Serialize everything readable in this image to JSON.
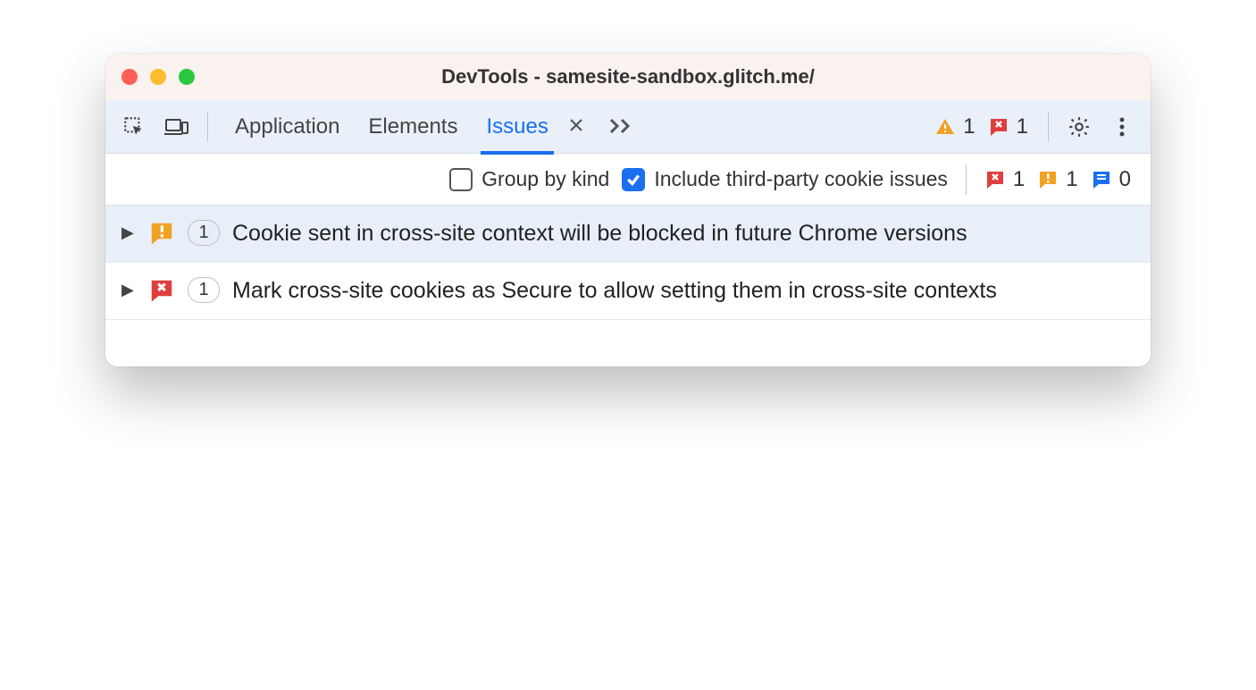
{
  "window": {
    "title": "DevTools - samesite-sandbox.glitch.me/"
  },
  "tabs": {
    "items": [
      {
        "label": "Application",
        "active": false
      },
      {
        "label": "Elements",
        "active": false
      },
      {
        "label": "Issues",
        "active": true
      }
    ]
  },
  "toolbar_counts": {
    "warning": "1",
    "error": "1"
  },
  "filters": {
    "group_by_kind": {
      "label": "Group by kind",
      "checked": false
    },
    "include_third_party": {
      "label": "Include third-party cookie issues",
      "checked": true
    }
  },
  "filter_counts": {
    "error": "1",
    "warning": "1",
    "info": "0"
  },
  "issues": [
    {
      "kind": "warning",
      "count": "1",
      "title": "Cookie sent in cross-site context will be blocked in future Chrome versions"
    },
    {
      "kind": "error",
      "count": "1",
      "title": "Mark cross-site cookies as Secure to allow setting them in cross-site contexts"
    }
  ],
  "colors": {
    "warning": "#f0a226",
    "error": "#e03e3e",
    "info": "#1a6ef0"
  }
}
